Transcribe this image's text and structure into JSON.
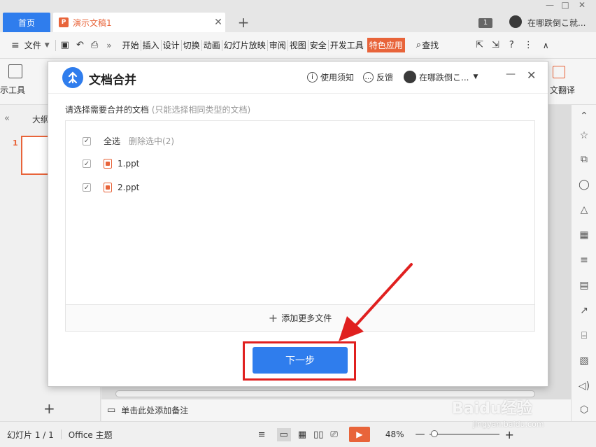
{
  "titlebar": {
    "home_tab": "首页",
    "doc_tab": "演示文稿1",
    "doc_tab_icon_letter": "P",
    "close_glyph": "✕",
    "add_tab_glyph": "+",
    "page_badge": "1",
    "user_name": "在哪跌倒こ就...",
    "win_minimize": "—",
    "win_maximize": "□",
    "win_close": "✕"
  },
  "menubar": {
    "file_label": "文件",
    "more_glyph": "»",
    "tabs": [
      "开始",
      "插入",
      "设计",
      "切换",
      "动画",
      "幻灯片放映",
      "审阅",
      "视图",
      "安全",
      "开发工具"
    ],
    "special_tab": "特色应用",
    "search_label": "查找"
  },
  "ribbon": {
    "left_tool_label": "示工具",
    "right_tool_label": "文翻译"
  },
  "leftpanel": {
    "collapse_glyph": "«",
    "outline_tab": "大纲",
    "slide_number": "1"
  },
  "notes": {
    "placeholder": "单击此处添加备注"
  },
  "statusbar": {
    "slide_info": "幻灯片 1 / 1",
    "theme": "Office 主题",
    "zoom": "48%"
  },
  "dialog": {
    "title": "文档合并",
    "help_label": "使用须知",
    "feedback_label": "反馈",
    "user_label": "在哪跌倒こ...",
    "instruction": "请选择需要合并的文档",
    "instruction_hint": "(只能选择相同类型的文档)",
    "select_all": "全选",
    "delete_selected": "删除选中(2)",
    "files": [
      "1.ppt",
      "2.ppt"
    ],
    "add_more": "添加更多文件",
    "next_button": "下一步"
  },
  "watermark": {
    "brand": "Baidu经验",
    "url": "jingyan.baidu.com"
  },
  "colors": {
    "accent_blue": "#2f7ded",
    "wps_orange": "#e8643a",
    "annotation_red": "#e0201f"
  }
}
